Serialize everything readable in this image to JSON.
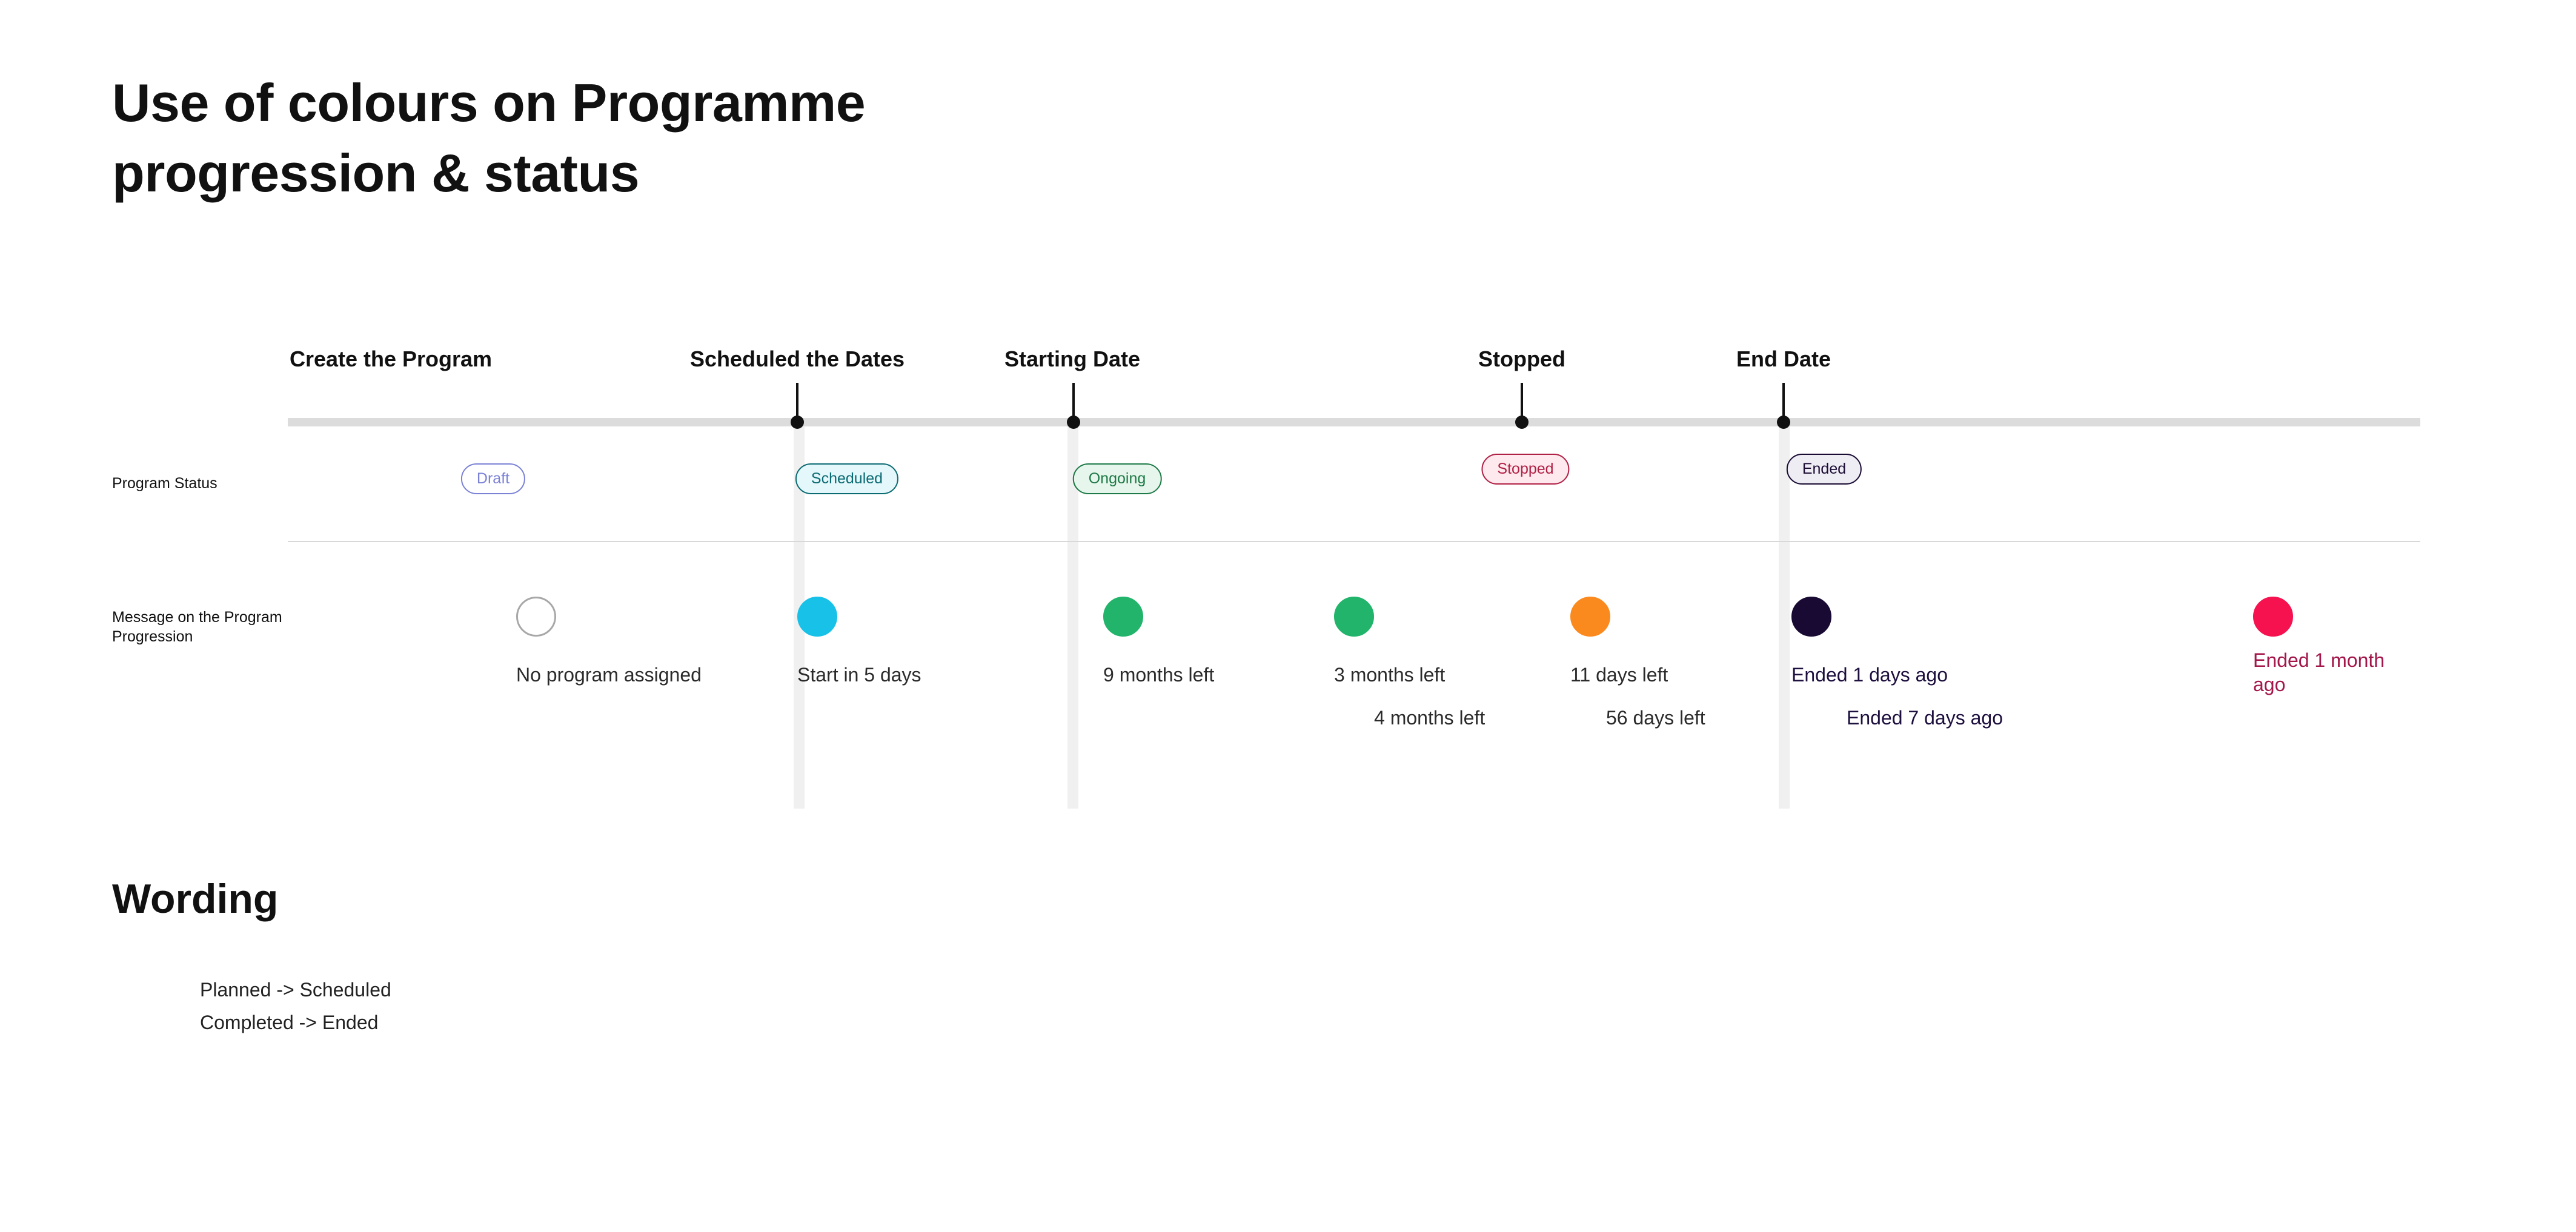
{
  "title": "Use of colours on Programme progression & status",
  "stages": [
    {
      "label": "Create the Program"
    },
    {
      "label": "Scheduled the Dates"
    },
    {
      "label": "Starting Date"
    },
    {
      "label": "Stopped"
    },
    {
      "label": "End Date"
    }
  ],
  "rows": {
    "status_label": "Program Status",
    "message_label": "Message on the Program Progression"
  },
  "badges": [
    {
      "label": "Draft",
      "color": "#7b82d6",
      "bg": "#ffffff"
    },
    {
      "label": "Scheduled",
      "color": "#0b6b73",
      "bg": "#e4f7fa"
    },
    {
      "label": "Ongoing",
      "color": "#1e7a47",
      "bg": "#e7f6ec"
    },
    {
      "label": "Stopped",
      "color": "#b01f44",
      "bg": "#fde9ee"
    },
    {
      "label": "Ended",
      "color": "#1a0b33",
      "bg": "#efedf4"
    }
  ],
  "progress": [
    {
      "color": "#ffffff",
      "border": "#a8a8a8",
      "message": "No program assigned",
      "secondary": ""
    },
    {
      "color": "#17c1e8",
      "border": "#17c1e8",
      "message": "Start in 5 days",
      "secondary": ""
    },
    {
      "color": "#22b46b",
      "border": "#22b46b",
      "message": "9 months left",
      "secondary": ""
    },
    {
      "color": "#22b46b",
      "border": "#22b46b",
      "message": "3 months left",
      "secondary": "4 months left"
    },
    {
      "color": "#fb8a1e",
      "border": "#fb8a1e",
      "message": "11 days left",
      "secondary": "56 days left"
    },
    {
      "color": "#180a33",
      "border": "#180a33",
      "message": "Ended 1 days ago",
      "secondary": "Ended 7 days ago"
    },
    {
      "color": "#f5124f",
      "border": "#f5124f",
      "message": "Ended 1 month ago",
      "secondary": ""
    }
  ],
  "message_colors": {
    "default": "#2b2b2b",
    "ended": "#1d0f3e",
    "ended_late": "#a3174a"
  },
  "wording": {
    "title": "Wording",
    "items": [
      "Planned -> Scheduled",
      "Completed -> Ended"
    ]
  }
}
